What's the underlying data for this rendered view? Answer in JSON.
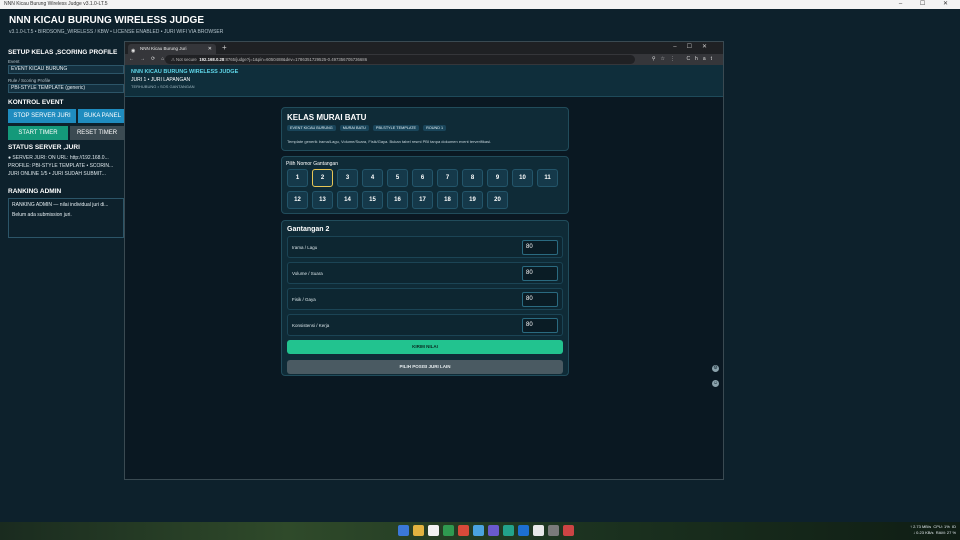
{
  "outer_window": {
    "title": "NNN Kicau Burung Wireless Judge v3.1.0-LT.5",
    "controls": "– ☐ ✕"
  },
  "app": {
    "title": "NNN KICAU BURUNG WIRELESS JUDGE",
    "subtitle": "v3.1.0-LT.5  •  BIRDSONG_WIRELESS / KBW  •  LICENSE ENABLED  •  JURI WIFI VIA BROWSER",
    "setup": {
      "heading": "SETUP KELAS ,SCORING PROFILE",
      "event_label": "Event",
      "event_value": "EVENT KICAU BURUNG",
      "rule_label": "Rule / Scoring Profile",
      "rule_value": "PBI-STYLE TEMPLATE (generic)"
    },
    "control": {
      "heading": "KONTROL EVENT",
      "stop_server": "STOP SERVER JURI",
      "open_panel": "BUKA PANEL",
      "start_timer": "START TIMER",
      "reset_timer": "RESET TIMER"
    },
    "status": {
      "heading": "STATUS SERVER ,JURI",
      "line1": "● SERVER JURI: ON    URL: http://192.168.0...",
      "line2": "PROFILE: PBI-STYLE TEMPLATE  •  SCORIN...",
      "line3": "JURI ONLINE 1/5  •  JURI SUDAH SUBMIT..."
    },
    "ranking": {
      "heading": "RANKING ADMIN",
      "line1": "RANKING ADMIN — nilai individual juri di...",
      "line2": "Belum ada submission juri."
    }
  },
  "browser": {
    "tab_title": "NNN Kicau Burung Juri",
    "url_prefix": "Not secure",
    "url_host": "192.168.0.28",
    "url_rest": ":8765/judge?j=1&pin=6050488&dev=1786351729525-0.497356705736686",
    "account": "Chat"
  },
  "judge": {
    "header_title": "NNN KICAU BURUNG WIRELESS JUDGE",
    "header_sub": "JURI 1 • JURI LAPANGAN",
    "header_small": "TERHUBUNG • SOS GANTANGAN",
    "class_title": "KELAS MURAI BATU",
    "chips": [
      "EVENT KICAU BURUNG",
      "MURAI BATU",
      "PBI-STYLE TEMPLATE",
      "ROUND 1"
    ],
    "class_desc": "Template generik Irama/Lagu, Volume/Suara, Fisik/Gaya. Bukan tabel resmi PBI tanpa dokumen event terverifikasi.",
    "pick_label": "Pilih Nomor Gantangan",
    "numbers": [
      "1",
      "2",
      "3",
      "4",
      "5",
      "6",
      "7",
      "8",
      "9",
      "10",
      "11",
      "12",
      "13",
      "14",
      "15",
      "16",
      "17",
      "18",
      "19",
      "20"
    ],
    "selected_index": 1,
    "score_title": "Gantangan 2",
    "criteria": [
      {
        "name": "Irama / Lagu",
        "value": "80"
      },
      {
        "name": "Volume / Suara",
        "value": "80"
      },
      {
        "name": "Fisik / Gaya",
        "value": "80"
      },
      {
        "name": "Konsistensi / Kerja",
        "value": "80"
      }
    ],
    "submit": "KIRIM NILAI",
    "other": "PILIH POSISI JURI LAIN"
  },
  "tray": {
    "net_up": "↑ 2.73 MB/s",
    "net_down": "↓ 0.23 KB/s",
    "cpu": "CPU: 1%",
    "ram": "RAM: 27 %",
    "lang": "ID"
  },
  "taskbar_icon_colors": [
    "#3b78d8",
    "#e2b340",
    "#f2f2f2",
    "#2f9a50",
    "#d84a3a",
    "#4aa3df",
    "#6a5acd",
    "#22a38a",
    "#1d6fd1",
    "#e8e8e8",
    "#7a7a7a",
    "#c44"
  ]
}
